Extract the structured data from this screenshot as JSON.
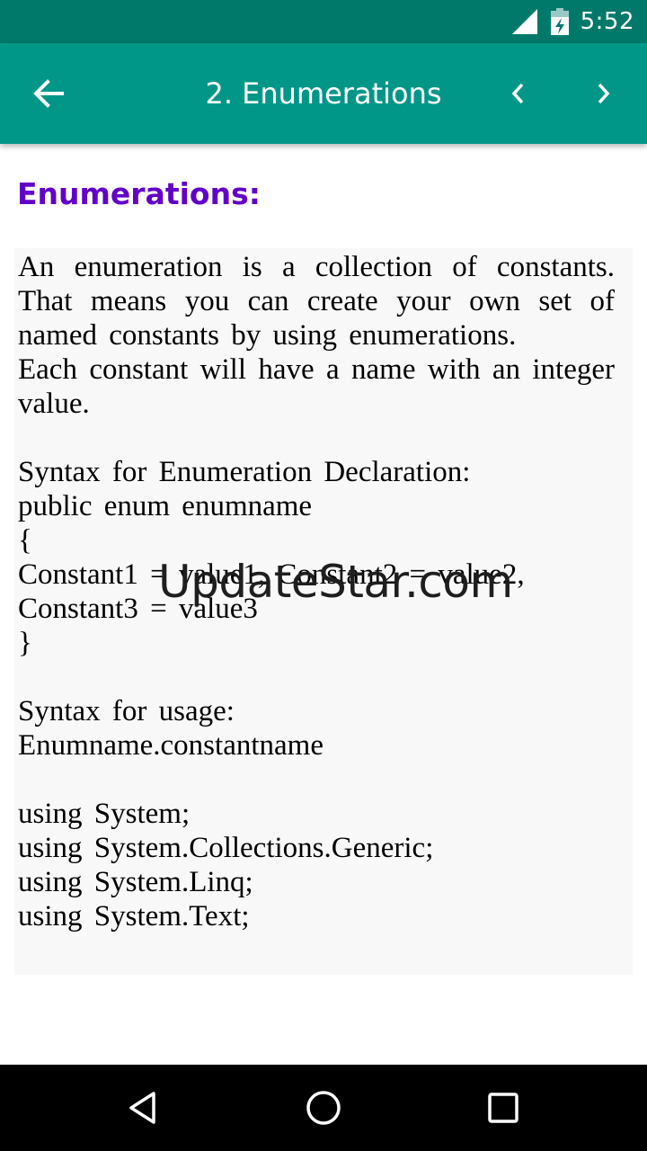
{
  "status_bar": {
    "time": "5:52"
  },
  "app_bar": {
    "title": "2. Enumerations"
  },
  "content": {
    "heading": "Enumerations:",
    "paragraph_lines": [
      "An enumeration is a collection of constants. That means you can create your own set of named constants by using enumerations.",
      "Each constant will have a name with an integer value."
    ],
    "syntax_label": "Syntax for Enumeration Declaration:",
    "code_lines": [
      "public enum enumname",
      "{",
      "Constant1 = value1, Constant2 = value2,",
      "Constant3 = value3",
      "}"
    ],
    "usage_label": "Syntax for usage:",
    "usage_code": "Enumname.constantname",
    "using_lines": [
      "using System;",
      "using System.Collections.Generic;",
      "using System.Linq;",
      "using System.Text;"
    ]
  },
  "watermark": "UpdateStar.com",
  "icons": {
    "signal": "cellular-signal-icon",
    "battery": "battery-charging-icon",
    "back": "arrow-back-icon",
    "prev": "chevron-left-icon",
    "next": "chevron-right-icon",
    "nav_back": "triangle-back-icon",
    "nav_home": "circle-home-icon",
    "nav_recents": "square-recents-icon"
  },
  "colors": {
    "status_bar": "#00796b",
    "app_bar": "#009688",
    "heading": "#6200c9",
    "body_box": "#f8f8f8",
    "nav_bar": "#000000"
  }
}
